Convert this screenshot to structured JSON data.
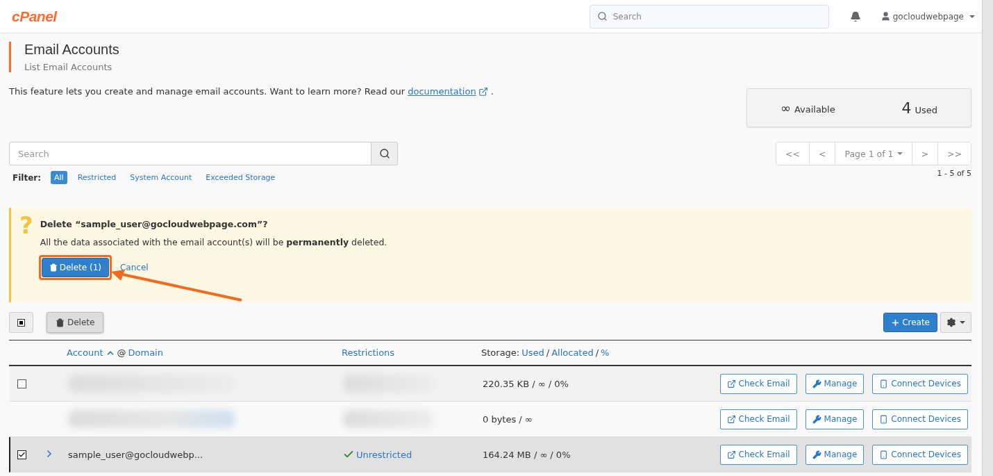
{
  "header": {
    "logo": "cPanel",
    "search_placeholder": "Search",
    "user": "gocloudwebpage"
  },
  "page": {
    "title": "Email Accounts",
    "subtitle": "List Email Accounts",
    "description": "This feature lets you create and manage email accounts. Want to learn more? Read our",
    "doc_link": "documentation",
    "description_end": "."
  },
  "stats": {
    "available_value": "∞",
    "available_label": "Available",
    "used_value": "4",
    "used_label": "Used"
  },
  "search": {
    "placeholder": "Search"
  },
  "filter": {
    "label": "Filter:",
    "options": [
      {
        "label": "All",
        "selected": true
      },
      {
        "label": "Restricted",
        "selected": false
      },
      {
        "label": "System Account",
        "selected": false
      },
      {
        "label": "Exceeded Storage",
        "selected": false
      }
    ]
  },
  "pagination": {
    "first": "<<",
    "prev": "<",
    "page": "Page 1 of 1",
    "next": ">",
    "last": ">>",
    "range": "1 - 5 of 5"
  },
  "alert": {
    "icon": "?",
    "title": "Delete “sample_user@gocloudwebpage.com”?",
    "message": "All the data associated with the email account(s) will be **permanently** deleted.",
    "confirm": "Delete (1)",
    "cancel": "Cancel",
    "highlighted": true
  },
  "toolbar": {
    "select_all_partial": true,
    "delete": "Delete",
    "create": "Create"
  },
  "table": {
    "columns": {
      "account": "Account",
      "at": "@",
      "domain": "Domain",
      "restrictions": "Restrictions",
      "storage": "Storage:",
      "used": "Used",
      "allocated": "Allocated",
      "percent": "%",
      "sep": "/"
    },
    "rows": [
      {
        "kind": "redacted",
        "checked": false,
        "selected": false,
        "storage": "220.35 KB / ∞ / 0%",
        "actions": [
          "Check Email",
          "Manage",
          "Connect Devices"
        ]
      },
      {
        "kind": "redacted",
        "selected": false,
        "storage": "0 bytes / ∞",
        "actions": [
          "Check Email",
          "Manage",
          "Connect Devices"
        ]
      },
      {
        "kind": "account",
        "checked": true,
        "selected": true,
        "account": "sample_user@gocloudwebp...",
        "restriction": "Unrestricted",
        "storage": "164.24 MB / ∞ / 0%",
        "actions": [
          "Check Email",
          "Manage",
          "Connect Devices"
        ]
      }
    ]
  }
}
